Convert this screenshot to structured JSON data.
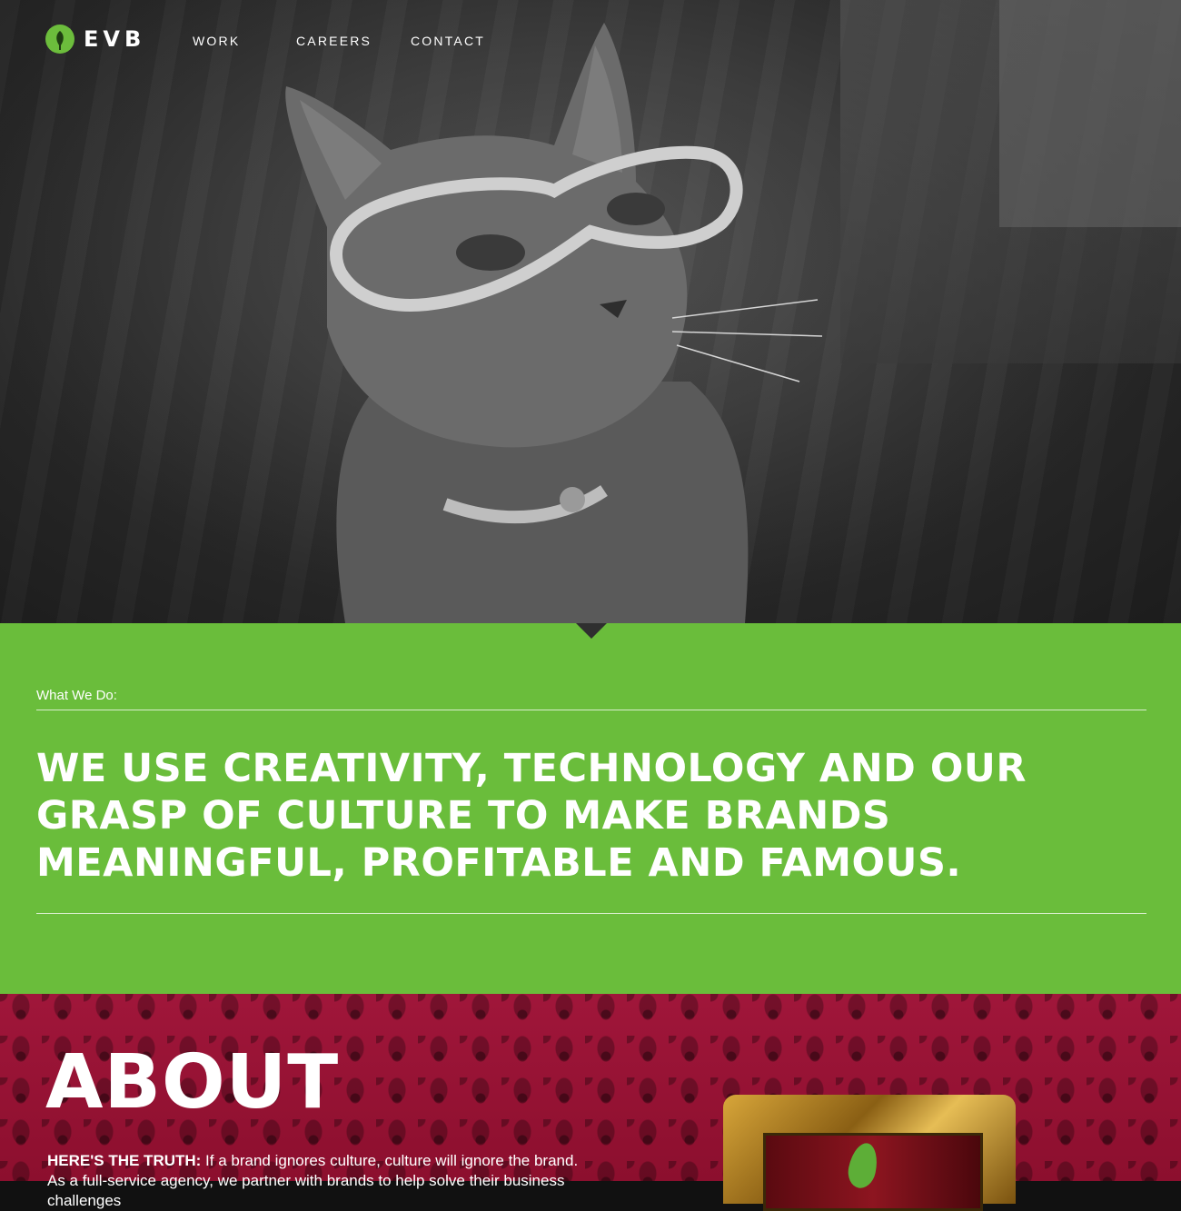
{
  "brand": {
    "logo_text": "EVB",
    "accent_color": "#6abd3b",
    "about_color": "#8c0f2e"
  },
  "nav": {
    "items": [
      {
        "label": "WORK"
      },
      {
        "label": "CAREERS"
      },
      {
        "label": "CONTACT"
      }
    ]
  },
  "hero": {
    "image_subject": "cat-with-goggles"
  },
  "what_we_do": {
    "kicker": "What We Do:",
    "headline": "WE USE CREATIVITY, TECHNOLOGY AND OUR GRASP OF CULTURE TO MAKE BRANDS MEANINGFUL, PROFITABLE AND FAMOUS."
  },
  "about": {
    "title": "ABOUT",
    "lead": "HERE'S THE TRUTH:",
    "body": " If a brand ignores culture, culture will ignore the brand. As a full-service agency, we partner with brands to help solve their business challenges"
  }
}
